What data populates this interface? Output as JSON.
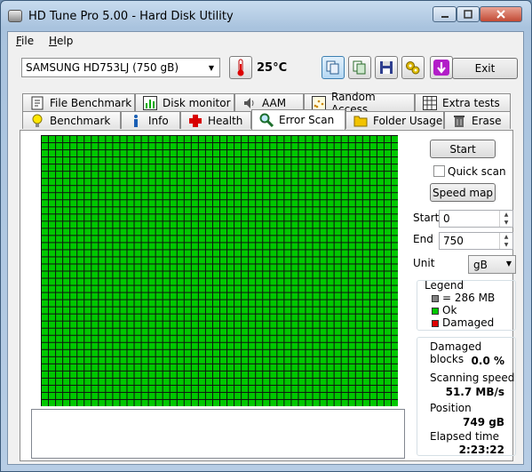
{
  "window": {
    "title": "HD Tune Pro 5.00 - Hard Disk Utility"
  },
  "menu": {
    "file_underline": "F",
    "file_rest": "ile",
    "help_underline": "H",
    "help_rest": "elp"
  },
  "drive": {
    "selected": "SAMSUNG HD753LJ (750 gB)"
  },
  "temperature": "25°C",
  "exit_label": "Exit",
  "tabs_row1": [
    {
      "label": "File Benchmark",
      "icon": "file-benchmark-icon"
    },
    {
      "label": "Disk monitor",
      "icon": "disk-monitor-icon"
    },
    {
      "label": "AAM",
      "icon": "speaker-icon"
    },
    {
      "label": "Random Access",
      "icon": "random-access-icon"
    },
    {
      "label": "Extra tests",
      "icon": "extra-tests-icon"
    }
  ],
  "tabs_row2": [
    {
      "label": "Benchmark",
      "icon": "lightbulb-icon"
    },
    {
      "label": "Info",
      "icon": "info-icon"
    },
    {
      "label": "Health",
      "icon": "health-cross-icon"
    },
    {
      "label": "Error Scan",
      "icon": "magnifier-icon",
      "active": true
    },
    {
      "label": "Folder Usage",
      "icon": "folder-icon"
    },
    {
      "label": "Erase",
      "icon": "trash-icon"
    }
  ],
  "scan": {
    "start_button": "Start",
    "quick_scan_label": "Quick scan",
    "quick_scan_checked": false,
    "speed_map_button": "Speed map",
    "start_label": "Start",
    "start_value": "0",
    "end_label": "End",
    "end_value": "750",
    "unit_label": "Unit",
    "unit_value": "gB",
    "grid_columns": 50,
    "grid_rows": 38,
    "block_color": "#00c800"
  },
  "legend": {
    "title": "Legend",
    "block_size": "= 286 MB",
    "ok": "Ok",
    "damaged": "Damaged",
    "colors": {
      "block": "#808080",
      "ok": "#00c800",
      "damaged": "#e00000"
    }
  },
  "stats": {
    "damaged_blocks_label": "Damaged blocks",
    "damaged_blocks_value": "0.0 %",
    "scanning_speed_label": "Scanning speed",
    "scanning_speed_value": "51.7 MB/s",
    "position_label": "Position",
    "position_value": "749 gB",
    "elapsed_label": "Elapsed time",
    "elapsed_value": "2:23:22"
  }
}
